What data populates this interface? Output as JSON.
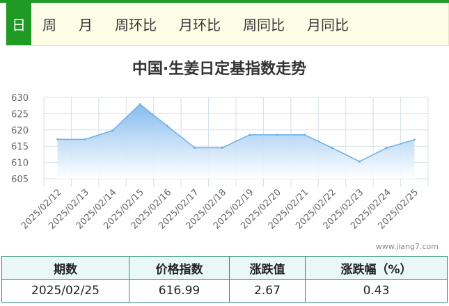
{
  "tabs": [
    "日",
    "周",
    "月",
    "周环比",
    "月环比",
    "周同比",
    "月同比"
  ],
  "active_tab": 0,
  "watermark": "www.jiang7.com",
  "colors": {
    "accent_green": "#1f9a25",
    "line": "#6aaee8",
    "area_top": "#7fb8ee",
    "area_bottom": "#ffffff",
    "table_border": "#2a8f7a",
    "table_header_bg": "#eaf7f7"
  },
  "chart_data": {
    "type": "area",
    "title": "中国·生姜日定基指数走势",
    "x": [
      "2025/02/12",
      "2025/02/13",
      "2025/02/14",
      "2025/02/15",
      "2025/02/16",
      "2025/02/17",
      "2025/02/18",
      "2025/02/19",
      "2025/02/20",
      "2025/02/21",
      "2025/02/22",
      "2025/02/23",
      "2025/02/24",
      "2025/02/25"
    ],
    "values": [
      617.1,
      617.1,
      619.8,
      627.9,
      621.2,
      614.5,
      614.5,
      618.5,
      618.5,
      618.5,
      614.5,
      610.3,
      614.5,
      616.99
    ],
    "ylim": [
      605,
      630
    ],
    "yticks": [
      605,
      610,
      615,
      620,
      625,
      630
    ],
    "xlabel": "",
    "ylabel": "",
    "grid": true
  },
  "table": {
    "headers": [
      "期数",
      "价格指数",
      "涨跌值",
      "涨跌幅（%）"
    ],
    "row": [
      "2025/02/25",
      "616.99",
      "2.67",
      "0.43"
    ]
  }
}
